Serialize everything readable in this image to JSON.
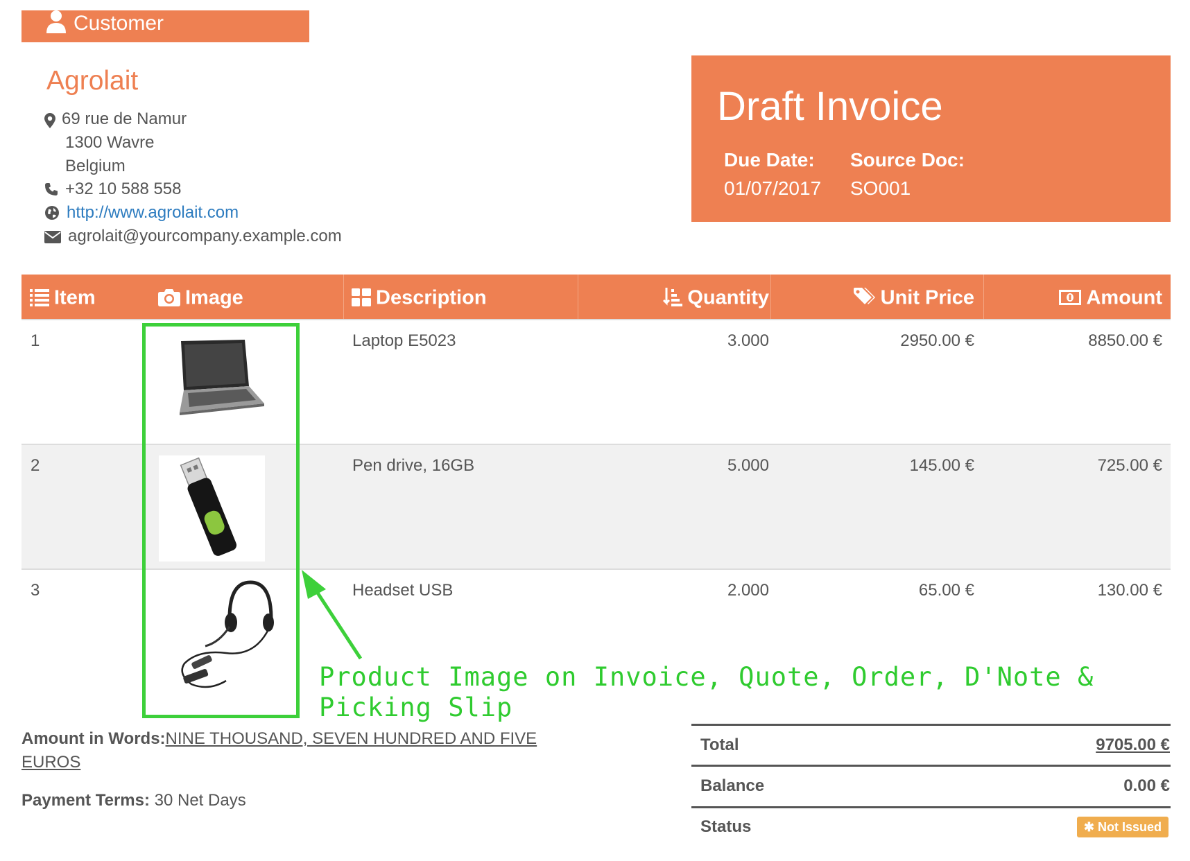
{
  "customer": {
    "header_label": "Customer",
    "name": "Agrolait",
    "address": [
      "69 rue de Namur",
      "1300 Wavre",
      "Belgium"
    ],
    "phone": "+32 10 588 558",
    "website": "http://www.agrolait.com",
    "email": "agrolait@yourcompany.example.com"
  },
  "invoice": {
    "title": "Draft Invoice",
    "due_date_label": "Due Date:",
    "due_date": "01/07/2017",
    "source_doc_label": "Source Doc:",
    "source_doc": "SO001"
  },
  "table": {
    "headers": {
      "item": "Item",
      "image": "Image",
      "description": "Description",
      "quantity": "Quantity",
      "unit_price": "Unit Price",
      "amount": "Amount"
    },
    "rows": [
      {
        "item": "1",
        "image": "laptop",
        "description": "Laptop E5023",
        "quantity": "3.000",
        "unit_price": "2950.00 €",
        "amount": "8850.00 €"
      },
      {
        "item": "2",
        "image": "pen-drive",
        "description": "Pen drive, 16GB",
        "quantity": "5.000",
        "unit_price": "145.00 €",
        "amount": "725.00 €"
      },
      {
        "item": "3",
        "image": "headset",
        "description": "Headset USB",
        "quantity": "2.000",
        "unit_price": "65.00 €",
        "amount": "130.00 €"
      }
    ]
  },
  "annotation": {
    "text": "Product Image on Invoice, Quote, Order, D'Note & Picking Slip"
  },
  "footer": {
    "amount_words_label": "Amount in Words:",
    "amount_words": "NINE THOUSAND, SEVEN HUNDRED AND FIVE EUROS",
    "payment_terms_label": "Payment Terms:",
    "payment_terms": "30 Net Days"
  },
  "totals": {
    "total_label": "Total",
    "total_value": "9705.00 €",
    "balance_label": "Balance",
    "balance_value": "0.00 €",
    "status_label": "Status",
    "status_value": "Not Issued"
  },
  "colors": {
    "accent": "#ee8052",
    "annotation": "#3dd03a",
    "badge": "#f0ad4e",
    "link": "#2c7bbf"
  }
}
